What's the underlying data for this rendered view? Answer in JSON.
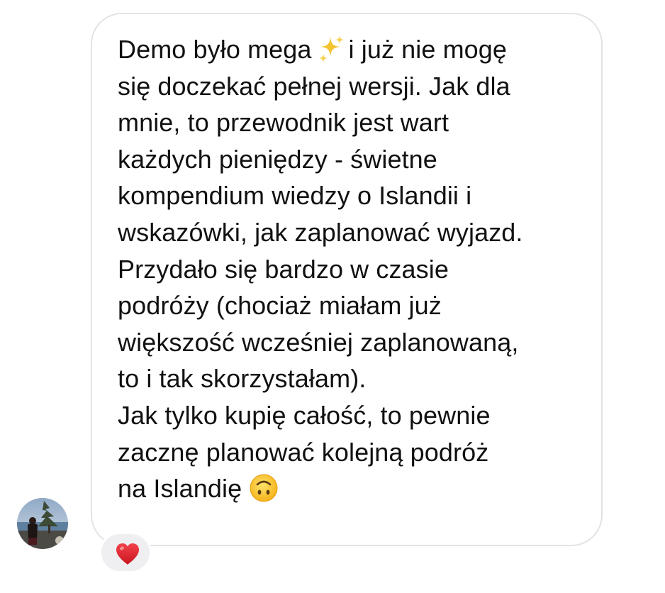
{
  "message": {
    "lines": [
      "Demo było mega",
      "i już nie mogę",
      "się doczekać pełnej wersji. Jak dla",
      "mnie, to przewodnik jest wart",
      "każdych pieniędzy - świetne",
      "kompendium wiedzy o Islandii i",
      "wskazówki, jak zaplanować wyjazd.",
      "Przydało się bardzo w czasie",
      "podróży (chociaż miałam już",
      "większość wcześniej zaplanowaną,",
      "to i tak skorzystałam).",
      "Jak tylko kupię całość, to pewnie",
      "zacznę planować kolejną podróż",
      "na Islandię"
    ],
    "emojis": {
      "first": "sparkles-emoji",
      "last": "upside-down-face-emoji"
    }
  },
  "reaction": {
    "icon": "heart-icon",
    "color": "#e0242b"
  },
  "colors": {
    "bubble_border": "#e3e3e6",
    "text": "#111111",
    "reaction_bg": "#efeff1"
  }
}
